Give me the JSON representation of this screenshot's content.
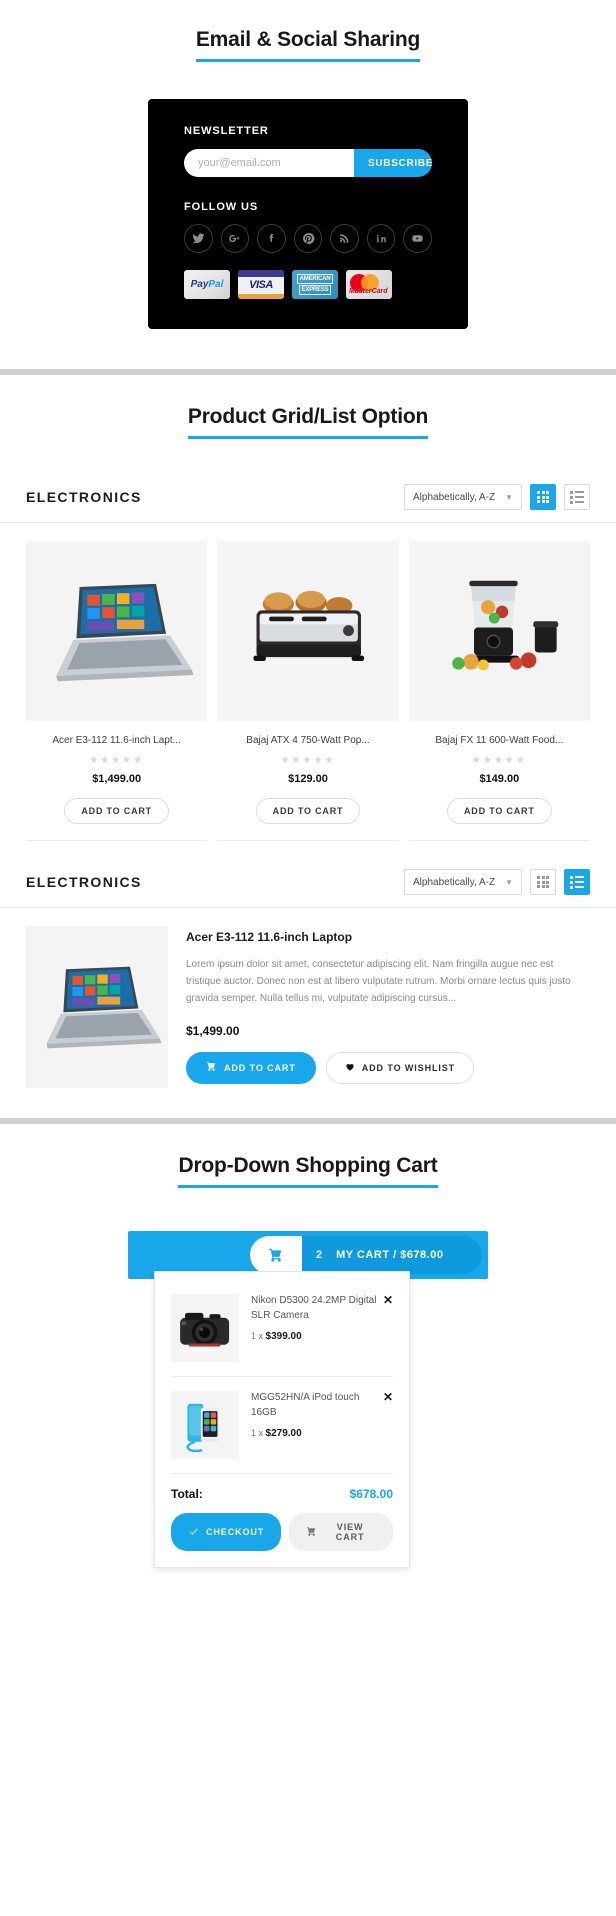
{
  "sections": {
    "email": {
      "title": "Email & Social Sharing"
    },
    "products": {
      "title": "Product Grid/List Option"
    },
    "cart": {
      "title": "Drop-Down Shopping Cart"
    }
  },
  "newsletter": {
    "heading": "NEWSLETTER",
    "placeholder": "your@email.com",
    "value": "",
    "submit_label": "SUBSCRIBE",
    "follow_heading": "FOLLOW US",
    "accent_color": "#18a7eb",
    "box_color": "#000000",
    "social": [
      {
        "name": "twitter-icon",
        "label": "Twitter"
      },
      {
        "name": "google-plus-icon",
        "label": "Google Plus"
      },
      {
        "name": "facebook-icon",
        "label": "Facebook"
      },
      {
        "name": "pinterest-icon",
        "label": "Pinterest"
      },
      {
        "name": "rss-icon",
        "label": "RSS"
      },
      {
        "name": "linkedin-icon",
        "label": "LinkedIn"
      },
      {
        "name": "youtube-icon",
        "label": "YouTube"
      }
    ],
    "payments": [
      {
        "name": "paypal-badge",
        "label": "PayPal"
      },
      {
        "name": "visa-badge",
        "label": "VISA"
      },
      {
        "name": "amex-badge",
        "label": "AMERICAN EXPRESS",
        "line1": "AMERICAN",
        "line2": "EXPRESS"
      },
      {
        "name": "mastercard-badge",
        "label": "MasterCard"
      }
    ]
  },
  "grid_section": {
    "category": "ELECTRONICS",
    "sort_value": "Alphabetically, A-Z",
    "view": "grid",
    "products": [
      {
        "name": "Acer E3-112 11.6-inch Lapt...",
        "price": "$1,499.00",
        "rating": "★★★★★",
        "button": "ADD TO CART",
        "image": "laptop"
      },
      {
        "name": "Bajaj ATX 4 750-Watt Pop...",
        "price": "$129.00",
        "rating": "★★★★★",
        "button": "ADD TO CART",
        "image": "toaster"
      },
      {
        "name": "Bajaj FX 11 600-Watt Food...",
        "price": "$149.00",
        "rating": "★★★★★",
        "button": "ADD TO CART",
        "image": "blender"
      }
    ]
  },
  "list_section": {
    "category": "ELECTRONICS",
    "sort_value": "Alphabetically, A-Z",
    "view": "list",
    "product": {
      "name": "Acer E3-112 11.6-inch Laptop",
      "description": "Lorem ipsum dolor sit amet, consectetur adipiscing elit. Nam fringilla augue nec est tristique auctor. Donec non est at libero vulputate rutrum. Morbi ornare lectus quis justo gravida semper. Nulla tellus mi, vulputate adipiscing cursus...",
      "price": "$1,499.00",
      "add_to_cart": "ADD TO CART",
      "add_to_wishlist": "ADD TO WISHLIST",
      "image": "laptop"
    }
  },
  "shopping_cart": {
    "count": "2",
    "label": "MY CART / $678.00",
    "items": [
      {
        "name": "Nikon D5300 24.2MP Digital SLR Camera",
        "qty_prefix": "1 x",
        "price": "$399.00",
        "remove": "✕",
        "image": "camera"
      },
      {
        "name": "MGG52HN/A iPod touch 16GB",
        "qty_prefix": "1 x",
        "price": "$279.00",
        "remove": "✕",
        "image": "ipod"
      }
    ],
    "total_label": "Total:",
    "total_value": "$678.00",
    "checkout_label": "CHECKOUT",
    "viewcart_label": "VIEW CART"
  }
}
